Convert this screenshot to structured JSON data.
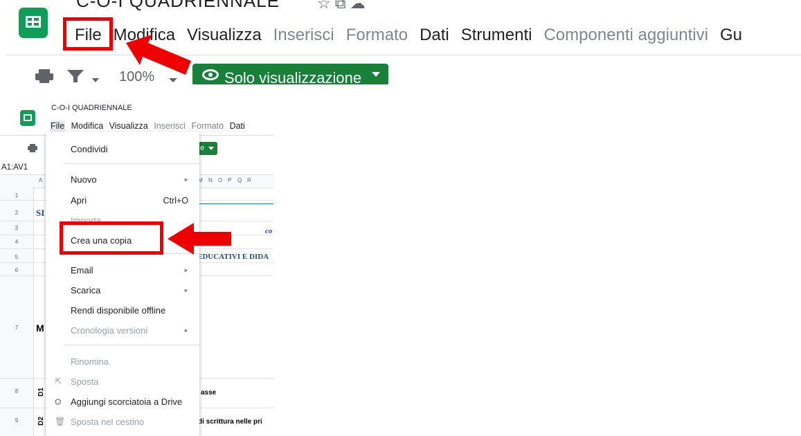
{
  "top": {
    "title_clip": "C-O-I QUADRIENNALE",
    "menu": [
      "File",
      "Modifica",
      "Visualizza",
      "Inserisci",
      "Formato",
      "Dati",
      "Strumenti",
      "Componenti aggiuntivi",
      "Gu"
    ],
    "zoom": "100%",
    "view_mode_button": "Solo visualizzazione"
  },
  "bottom": {
    "title_clip": "C-O-I QUADRIENNALE",
    "menu": [
      "File",
      "Modifica",
      "Visualizza",
      "Inserisci",
      "Formato",
      "Dati"
    ],
    "view_mode_button_clip": "e",
    "namebox": "A1:AV1",
    "columns": [
      "A",
      "M",
      "N",
      "O",
      "P",
      "Q",
      "R"
    ],
    "rows": [
      "1",
      "2",
      "3",
      "4",
      "5",
      "6",
      "7",
      "8",
      "9"
    ],
    "cells": {
      "row2": "SI",
      "row3": "co",
      "row5": "EDUCATIVI E DIDA",
      "row7": "M",
      "row8_code": "D1",
      "row8_text": "asse",
      "row9_code": "D2",
      "row9_text": "di scrittura nelle pri"
    }
  },
  "file_menu": {
    "items": [
      {
        "label": "Condividi"
      },
      {
        "label": "Nuovo"
      },
      {
        "label": "Apri",
        "shortcut": "Ctrl+O"
      },
      {
        "label": "Importa"
      },
      {
        "label": "Crea una copia"
      },
      {
        "label": "Email"
      },
      {
        "label": "Scarica"
      },
      {
        "label": "Rendi disponibile offline"
      },
      {
        "label": "Cronologia versioni"
      },
      {
        "label": "Rinomina"
      },
      {
        "label": "Sposta"
      },
      {
        "label": "Aggiungi scorciatoia a Drive"
      },
      {
        "label": "Sposta nel cestino"
      }
    ]
  },
  "colors": {
    "sheets_green": "#0f9d58",
    "button_green": "#188038",
    "highlight_red": "#ee0000"
  }
}
